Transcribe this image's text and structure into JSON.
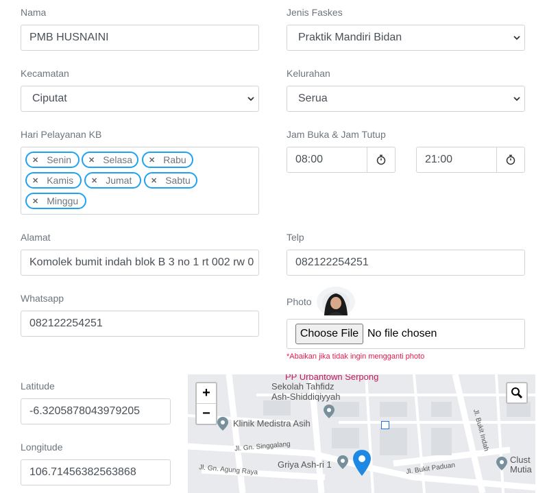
{
  "form": {
    "nama": {
      "label": "Nama",
      "value": "PMB HUSNAINI"
    },
    "jenis_faskes": {
      "label": "Jenis Faskes",
      "value": "Praktik Mandiri Bidan"
    },
    "kecamatan": {
      "label": "Kecamatan",
      "value": "Ciputat"
    },
    "kelurahan": {
      "label": "Kelurahan",
      "value": "Serua"
    },
    "hari": {
      "label": "Hari Pelayanan KB",
      "tags": [
        "Senin",
        "Selasa",
        "Rabu",
        "Kamis",
        "Jumat",
        "Sabtu",
        "Minggu"
      ]
    },
    "jam": {
      "label": "Jam Buka & Jam Tutup",
      "buka": "08:00",
      "tutup": "21:00"
    },
    "alamat": {
      "label": "Alamat",
      "value": "Komolek bumit indah blok B 3 no 1 rt 002 rw 0"
    },
    "telp": {
      "label": "Telp",
      "value": "082122254251"
    },
    "whatsapp": {
      "label": "Whatsapp",
      "value": "082122254251"
    },
    "photo": {
      "label": "Photo",
      "button": "Choose File",
      "status": "No file chosen",
      "note": "*Abaikan jika tidak ingin mengganti photo"
    },
    "latitude": {
      "label": "Latitude",
      "value": "-6.3205878043979205"
    },
    "longitude": {
      "label": "Longitude",
      "value": "106.71456382563868"
    }
  },
  "map": {
    "zoom_in": "+",
    "zoom_out": "−",
    "labels": {
      "top": "PP Urbantown Serpong",
      "school1": "Sekolah Tahfidz",
      "school2": "Ash-Shiddiqiyyah",
      "clinic": "Klinik Medistra Asih",
      "street1": "Jl. Gn. Singgalang",
      "street2": "Jl. Gn. Agung Raya",
      "griya": "Griya Ash-ri 1",
      "street3": "Jl. Bukit Paduan",
      "street4": "Jl. Bukit Indah",
      "cluster1": "Clust",
      "cluster2": "Mutia"
    },
    "marker_color": "#1e88e5"
  },
  "colors": {
    "tag_border": "#1da1f2",
    "note": "#e8174c"
  },
  "icons": [
    "chevron-down-icon",
    "timer-icon",
    "remove-tag-icon",
    "map-search-icon",
    "map-marker-icon"
  ]
}
